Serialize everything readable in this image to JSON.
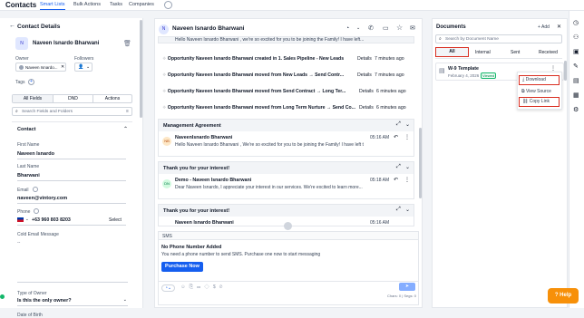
{
  "topnav": {
    "brand": "Contacts",
    "tabs": [
      "Smart Lists",
      "Bulk Actions",
      "Tasks",
      "Companies"
    ],
    "settings_icon": "gear-icon"
  },
  "left": {
    "title": "Contact Details",
    "contact_name": "Naveen Isnardo Bharwani",
    "owner_label": "Owner",
    "followers_label": "Followers",
    "owner_value": "Naveen Isnardo...",
    "tags_label": "Tags",
    "tabs": [
      "All Fields",
      "DND",
      "Actions"
    ],
    "search_placeholder": "Search Fields and Folders",
    "section": "Contact",
    "fields": [
      {
        "label": "First Name",
        "value": "Naveen Isnardo"
      },
      {
        "label": "Last Name",
        "value": "Bharwani"
      },
      {
        "label": "Email",
        "value": "naveen@vintory.com"
      }
    ],
    "phone_label": "Phone",
    "phone_value": "+63 960 803 8203",
    "phone_select": "Select",
    "cold_email_label": "Cold Email Message",
    "cold_email_value": "--",
    "owner_type_label": "Type of Owner",
    "owner_type_value": "Is this the only owner?",
    "dob_label": "Date of Birth"
  },
  "mid": {
    "header_name": "Naveen Isnardo Bharwani",
    "avatar": "N",
    "truncated_msg": "Hello Naveen Isnardo Bharwani , we're so excited for you to be joining the Family! I have left...",
    "activities": [
      {
        "pre": "Opportunity ",
        "name": "Naveen Isnardo Bharwani",
        "mid": " created in 1. Sales Pipeline - New Leads",
        "link": "Details",
        "time": "7 minutes ago"
      },
      {
        "pre": "Opportunity ",
        "name": "Naveen Isnardo Bharwani",
        "mid": " moved from New Leads → Send Contr...",
        "link": "Details",
        "time": "7 minutes ago"
      },
      {
        "pre": "Opportunity ",
        "name": "Naveen Isnardo Bharwani",
        "mid": " moved from Send Contract → Long Ter...",
        "link": "Details",
        "time": "6 minutes ago"
      },
      {
        "pre": "Opportunity ",
        "name": "Naveen Isnardo Bharwani",
        "mid": " moved from Long Term Nurture → Send Co...",
        "link": "Details",
        "time": "6 minutes ago"
      }
    ],
    "cards": [
      {
        "title": "Management Agreement",
        "avatar": "NB",
        "sender": "NaveenIsnardo Bharwani",
        "time": "05:16 AM",
        "text": "Hello Naveen Isnardo Bharwani , We're so excited for you to be joining the Family! I have left the..."
      },
      {
        "title": "Thank you for your interest!",
        "avatar": "DN",
        "sender": "Demo - Naveen Isnardo Bharwani",
        "time": "05:18 AM",
        "text": "Dear Naveen Isnardo, I appreciate your interest in our services. We're excited to learn more..."
      },
      {
        "title": "Thank you for your interest!",
        "avatar": "NB",
        "sender": "Naveen Isnardo Bharwani",
        "time": "05:16 AM",
        "text": ""
      }
    ],
    "sms_label": "SMS",
    "no_phone_title": "No Phone Number Added",
    "no_phone_text": "You need a phone number to send SMS. Purchase one now to start messaging",
    "purchase_button": "Purchase Now",
    "counter": "Chars: 0 | Segs: 0"
  },
  "right": {
    "title": "Documents",
    "add_label": "+ Add",
    "search_placeholder": "Search by Document Name",
    "tabs": [
      "All",
      "Internal",
      "Sent",
      "Received"
    ],
    "doc_name": "W-9 Template",
    "doc_date": "February 4, 2026",
    "doc_status": "Viewed",
    "menu": [
      "Download",
      "View Source",
      "Copy Link"
    ]
  },
  "help": {
    "label": "Help"
  },
  "colors": {
    "accent": "#155eef",
    "highlight": "#d92d20",
    "viewed": "#12b76a"
  }
}
